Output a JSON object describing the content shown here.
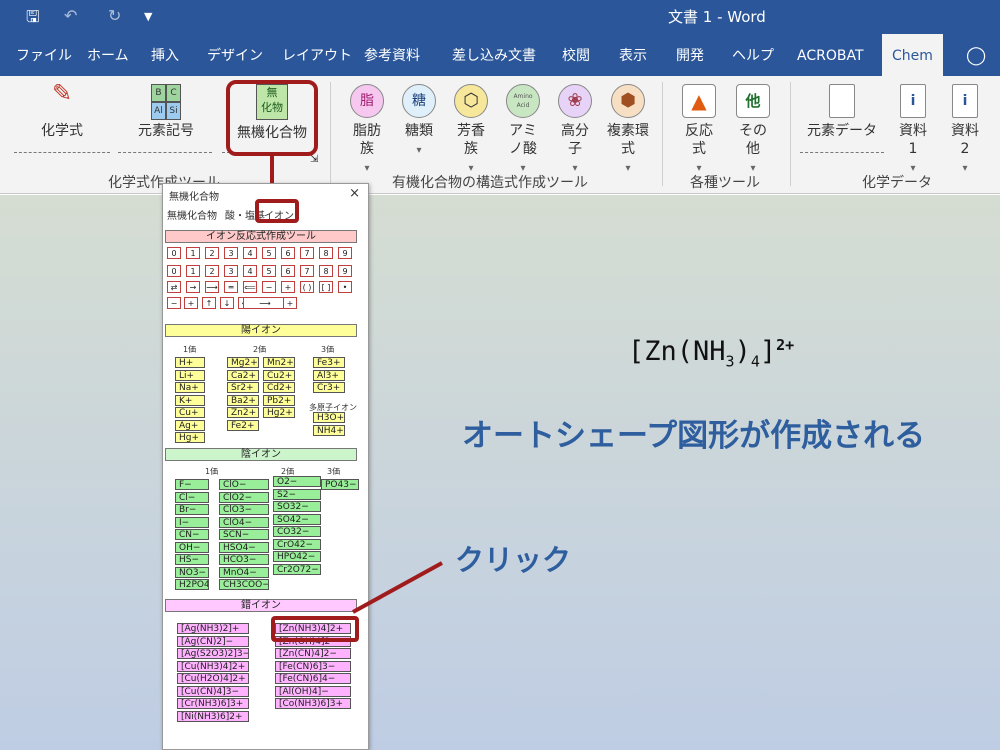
{
  "window": {
    "title": "文書 1 - Word",
    "save_icon": "save-icon",
    "undo_icon": "undo-icon",
    "redo_icon": "redo-icon"
  },
  "tabs": [
    "ファイル",
    "ホーム",
    "挿入",
    "デザイン",
    "レイアウト",
    "参考資料",
    "差し込み文書",
    "校閲",
    "表示",
    "開発",
    "ヘルプ",
    "ACROBAT",
    "Chem"
  ],
  "active_tab": "Chem",
  "ribbon": {
    "kagakushiki": "化学式",
    "genso_kigo": "元素記号",
    "genso_glyphs": [
      "B",
      "C",
      "Al",
      "Si"
    ],
    "muki_icon_glyph": "無\n化物",
    "muki": "無機化合物",
    "group1": "化学式作成ツール",
    "shibouzoku": "脂肪族",
    "shibou_glyph": "脂",
    "toorui": "糖類",
    "tou_glyph": "糖",
    "houkouzoku": "芳香族",
    "amino": "アミノ酸",
    "amino_glyph": "Amino Acid",
    "koubunshi": "高分子",
    "fukuso": "複素環式",
    "group2": "有機化合物の構造式作成ツール",
    "hannou": "反応式",
    "sonota": "その他",
    "sonota_glyph": "他",
    "group3": "各種ツール",
    "genso_data": "元素データ",
    "shiryo1": "資料1",
    "shiryo2": "資料2",
    "group4": "化学データ"
  },
  "panel": {
    "title": "無機化合物",
    "close": "×",
    "tabs": [
      "無機化合物",
      "酸・塩基",
      "イオン"
    ],
    "tool_header": "イオン反応式作成ツール",
    "digits": [
      "0",
      "1",
      "2",
      "3",
      "4",
      "5",
      "6",
      "7",
      "8",
      "9"
    ],
    "sub_digits": [
      "0",
      "1",
      "2",
      "3",
      "4",
      "5",
      "6",
      "7",
      "8",
      "9"
    ],
    "ops1": [
      "⇄",
      "→",
      "⟶",
      "═",
      "⟸",
      "−",
      "+",
      "( )",
      "[ ]",
      "•"
    ],
    "ops2": [
      "−",
      "+",
      "↑",
      "↓",
      "←",
      "⟶",
      "+"
    ],
    "cation_header": "陽イオン",
    "cation_cols": [
      "1価",
      "2価",
      "3価"
    ],
    "polyatomic_label": "多原子イオン",
    "cations_1": [
      "H+",
      "Li+",
      "Na+",
      "K+",
      "Cu+",
      "Ag+",
      "Hg+"
    ],
    "cations_2": [
      "Mg2+",
      "Ca2+",
      "Sr2+",
      "Ba2+",
      "Zn2+",
      "Fe2+"
    ],
    "cations_2b": [
      "Mn2+",
      "Cu2+",
      "Cd2+",
      "Pb2+",
      "Hg2+"
    ],
    "cations_3": [
      "Fe3+",
      "Al3+",
      "Cr3+"
    ],
    "cations_poly": [
      "H3O+",
      "NH4+"
    ],
    "anion_header": "陰イオン",
    "anion_cols": [
      "1価",
      "2価",
      "3価"
    ],
    "anions_1a": [
      "F−",
      "Cl−",
      "Br−",
      "I−",
      "CN−",
      "OH−",
      "HS−",
      "NO3−",
      "H2PO4−"
    ],
    "anions_1b": [
      "ClO−",
      "ClO2−",
      "ClO3−",
      "ClO4−",
      "SCN−",
      "HSO4−",
      "HCO3−",
      "MnO4−",
      "CH3COO−"
    ],
    "anions_2": [
      "O2−",
      "S2−",
      "SO32−",
      "SO42−",
      "CO32−",
      "CrO42−",
      "HPO42−",
      "Cr2O72−"
    ],
    "anions_3": [
      "PO43−"
    ],
    "complex_header": "錯イオン",
    "complex_a": [
      "[Ag(NH3)2]+",
      "[Ag(CN)2]−",
      "[Ag(S2O3)2]3−",
      "[Cu(NH3)4]2+",
      "[Cu(H2O)4]2+",
      "[Cu(CN)4]3−",
      "[Cr(NH3)6]3+",
      "[Ni(NH3)6]2+"
    ],
    "complex_b": [
      "[Zn(NH3)4]2+",
      "[Zn(OH)4]2−",
      "[Zn(CN)4]2−",
      "[Fe(CN)6]3−",
      "[Fe(CN)6]4−",
      "[Al(OH)4]−",
      "[Co(NH3)6]3+"
    ]
  },
  "annotation": {
    "formula_main": "[Zn(NH",
    "formula_sub3": "3",
    "formula_close": ")",
    "formula_sub4": "4",
    "formula_bracket": "]",
    "formula_charge": "2+",
    "caption": "オートシェープ図形が作成される",
    "click_label": "クリック"
  },
  "colors": {
    "titlebar": "#2b579a",
    "highlight": "#a01c1c",
    "annotation_text": "#2e5e9e",
    "cation": "#ffff99",
    "anion": "#99ee99",
    "complex": "#ffb3ff"
  }
}
